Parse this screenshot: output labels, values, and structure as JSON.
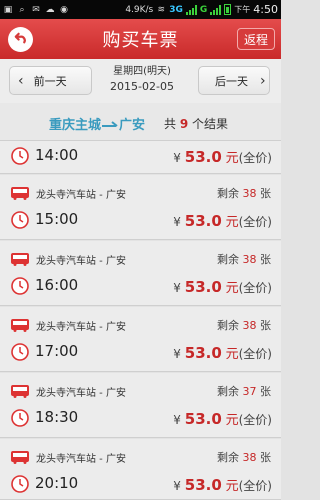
{
  "status_bar": {
    "net_speed": "4.9K/s",
    "net_3g": "3G",
    "net_g": "G",
    "ampm": "下午",
    "time": "4:50"
  },
  "header": {
    "title": "购买车票",
    "return_label": "返程"
  },
  "date_bar": {
    "prev_label": "前一天",
    "next_label": "后一天",
    "weekday": "星期四(明天)",
    "date": "2015-02-05"
  },
  "route": {
    "from": "重庆主城",
    "to": "广安",
    "count_prefix": "共",
    "count": "9",
    "count_suffix": "个结果"
  },
  "trips": [
    {
      "station": "",
      "remain_prefix": "",
      "remain": "",
      "remain_suffix": "",
      "time": "14:00",
      "yen": "¥",
      "price": "53.0",
      "unit": "元",
      "fare_type": "(全价)"
    },
    {
      "station": "龙头寺汽车站 - 广安",
      "remain_prefix": "剩余",
      "remain": "38",
      "remain_suffix": "张",
      "time": "15:00",
      "yen": "¥",
      "price": "53.0",
      "unit": "元",
      "fare_type": "(全价)"
    },
    {
      "station": "龙头寺汽车站 - 广安",
      "remain_prefix": "剩余",
      "remain": "38",
      "remain_suffix": "张",
      "time": "16:00",
      "yen": "¥",
      "price": "53.0",
      "unit": "元",
      "fare_type": "(全价)"
    },
    {
      "station": "龙头寺汽车站 - 广安",
      "remain_prefix": "剩余",
      "remain": "38",
      "remain_suffix": "张",
      "time": "17:00",
      "yen": "¥",
      "price": "53.0",
      "unit": "元",
      "fare_type": "(全价)"
    },
    {
      "station": "龙头寺汽车站 - 广安",
      "remain_prefix": "剩余",
      "remain": "37",
      "remain_suffix": "张",
      "time": "18:30",
      "yen": "¥",
      "price": "53.0",
      "unit": "元",
      "fare_type": "(全价)"
    },
    {
      "station": "龙头寺汽车站 - 广安",
      "remain_prefix": "剩余",
      "remain": "38",
      "remain_suffix": "张",
      "time": "20:10",
      "yen": "¥",
      "price": "53.0",
      "unit": "元",
      "fare_type": "(全价)"
    }
  ],
  "colors": {
    "header_red": "#d63b3b",
    "accent_red": "#c62828",
    "route_blue": "#3a9bbf"
  }
}
